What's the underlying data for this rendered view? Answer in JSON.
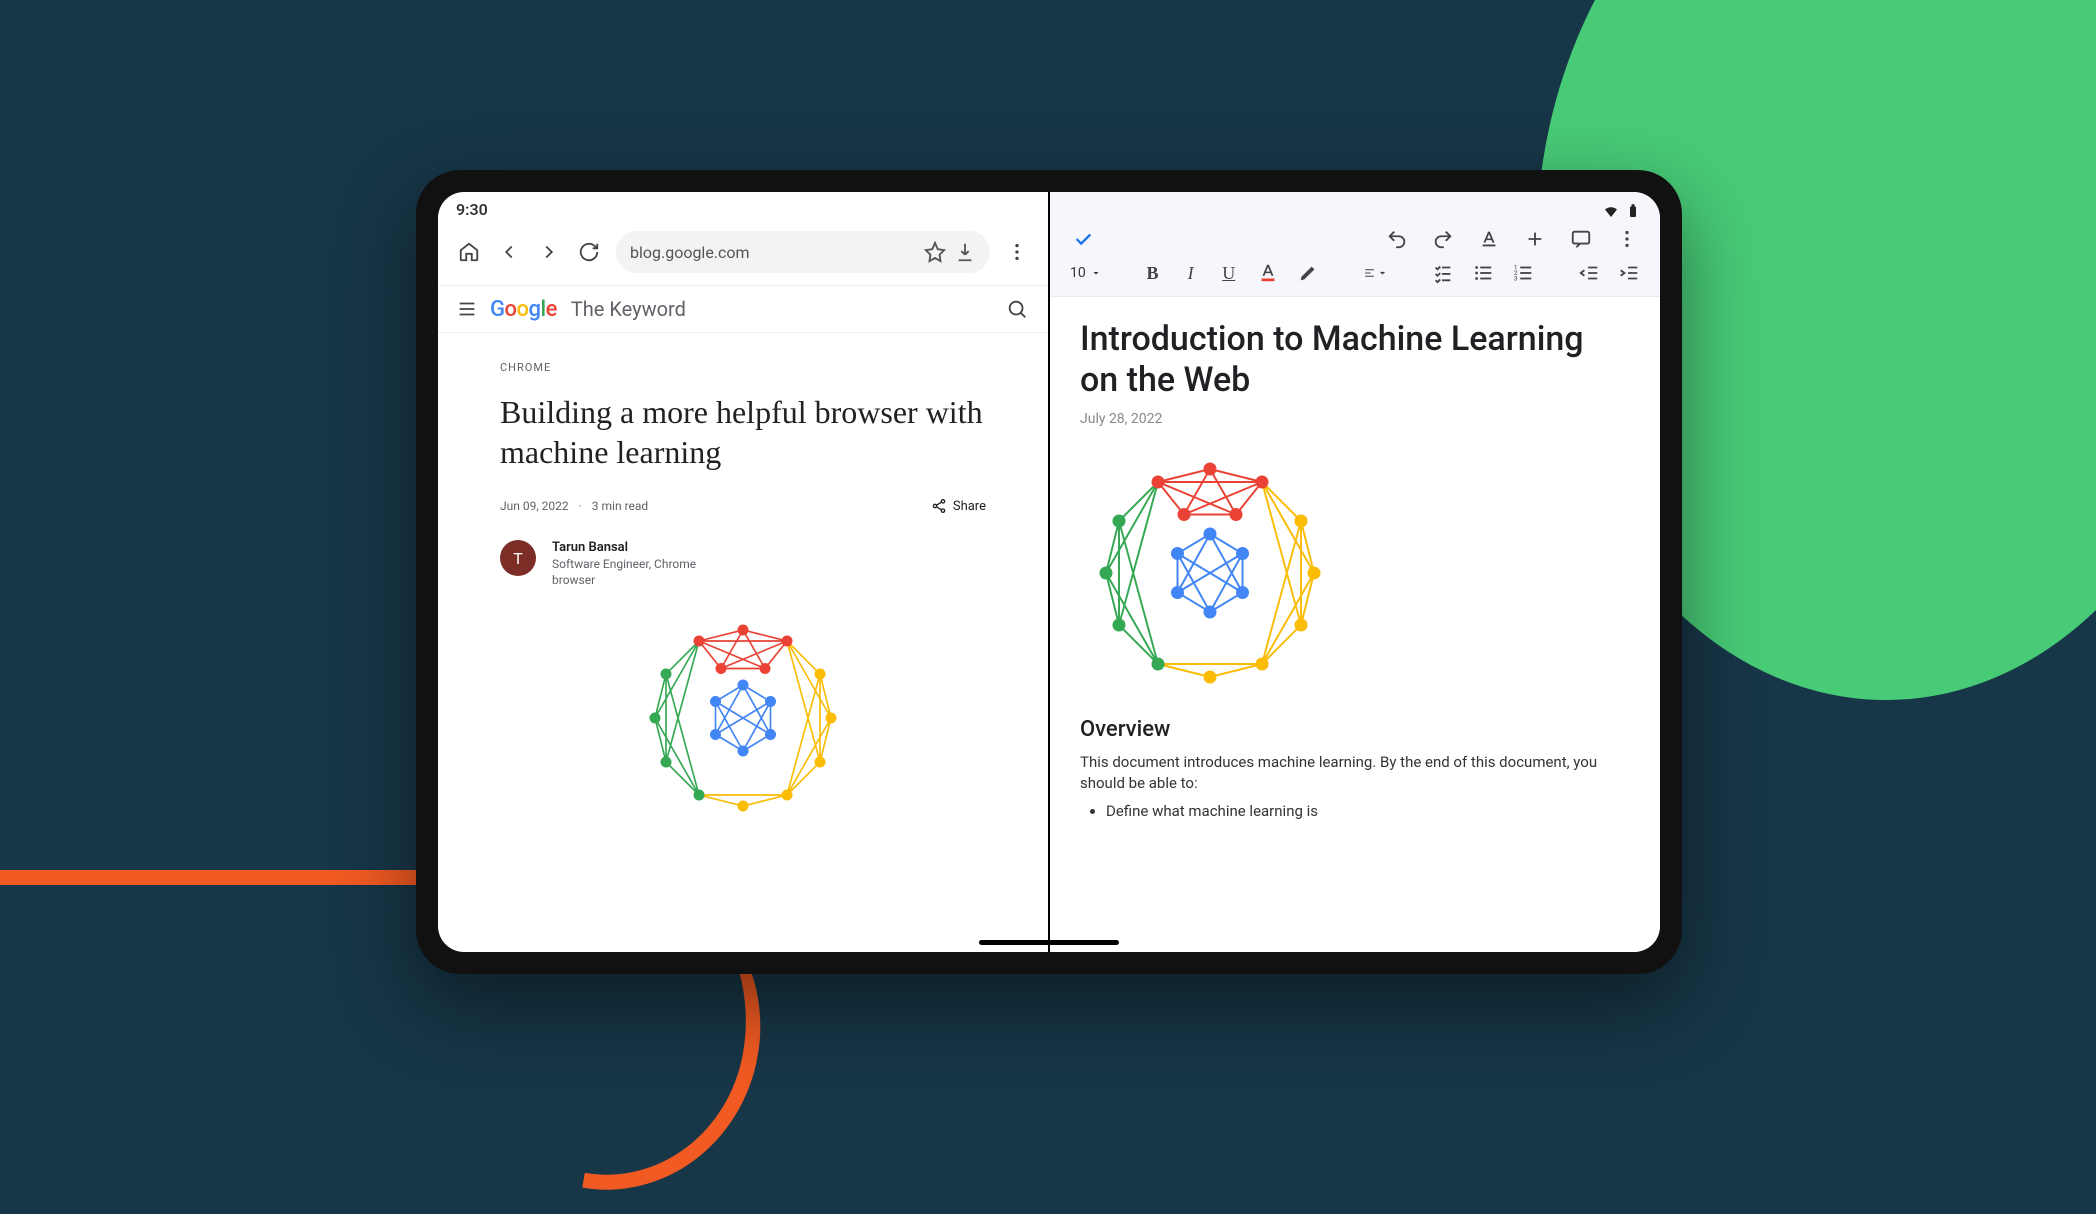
{
  "status": {
    "time": "9:30"
  },
  "browser": {
    "url": "blog.google.com",
    "site_name": "The Keyword",
    "category": "CHROME",
    "headline": "Building a more helpful browser with machine learning",
    "date": "Jun 09, 2022",
    "read_time": "3 min read",
    "share_label": "Share",
    "author": {
      "initial": "T",
      "name": "Tarun Bansal",
      "title": "Software Engineer, Chrome browser"
    }
  },
  "doc": {
    "font_size": "10",
    "title": "Introduction to Machine Learning on the Web",
    "date": "July 28, 2022",
    "overview_heading": "Overview",
    "overview_body": "This document introduces machine learning. By the end of this document, you should be able to:",
    "bullet1": "Define what machine learning is"
  }
}
